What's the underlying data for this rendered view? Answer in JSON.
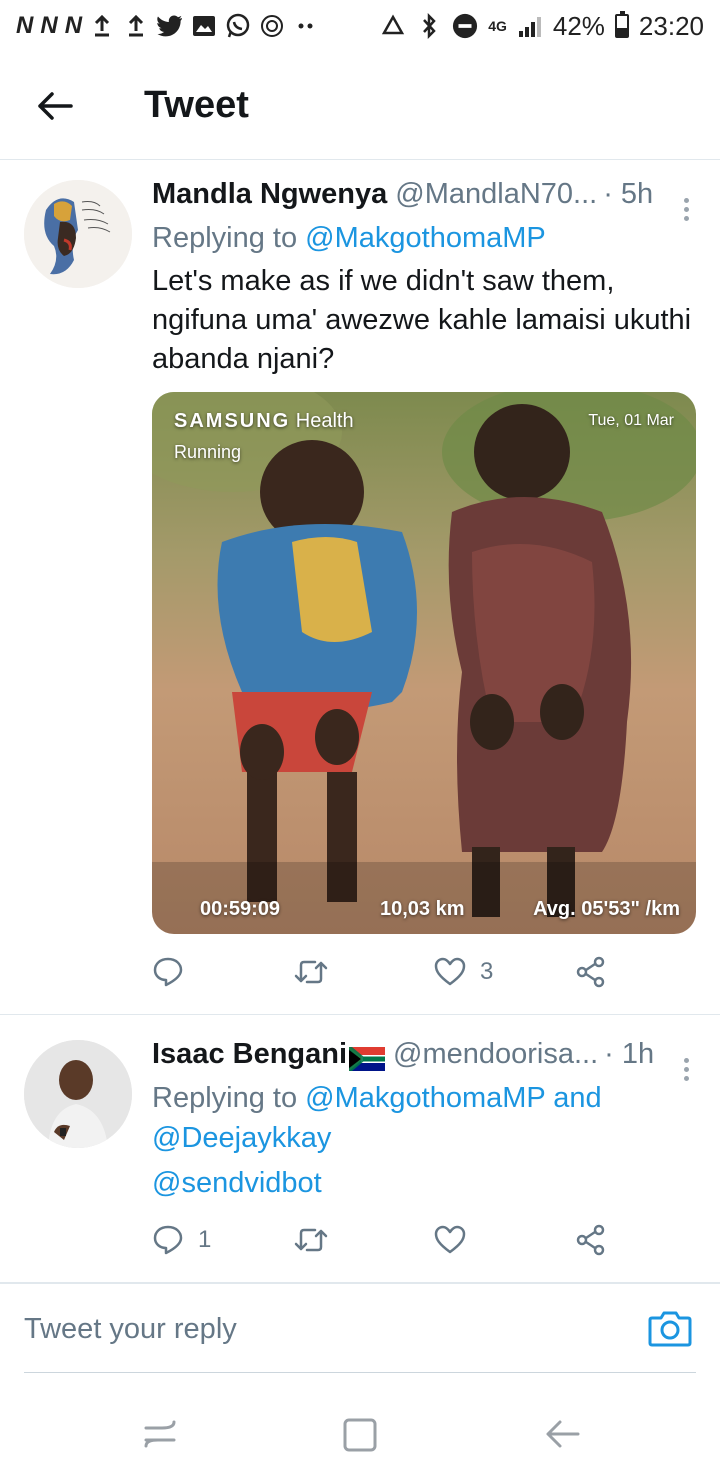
{
  "status_bar": {
    "left_icons": [
      "N",
      "N",
      "N",
      "upload-icon",
      "upload-icon",
      "twitter-icon",
      "gallery-icon",
      "whatsapp-icon",
      "sync-icon",
      "dots-icon"
    ],
    "right_icons": [
      "recycle-icon",
      "bluetooth-icon",
      "do-not-disturb-icon",
      "4g-icon",
      "signal-icon"
    ],
    "network": "4G",
    "battery": "42%",
    "time": "23:20"
  },
  "header": {
    "title": "Tweet"
  },
  "tweets": [
    {
      "name": "Mandla Ngwenya",
      "handle": "@MandlaN70...",
      "time": "· 5h",
      "replying_prefix": "Replying to",
      "replying_to": [
        "@MakgothomaMP"
      ],
      "text": "Let's make as if we didn't saw them, ngifuna uma' awezwe kahle lamaisi ukuthi abanda njani?",
      "media": {
        "brand": "SAMSUNG",
        "brand_suffix": "Health",
        "activity": "Running",
        "date": "Tue, 01 Mar",
        "duration": "00:59:09",
        "distance": "10,03 km",
        "pace": "Avg. 05'53\" /km"
      },
      "actions": {
        "reply_count": "",
        "retweet_count": "",
        "like_count": "3"
      }
    },
    {
      "name": "Isaac Bengani",
      "flag": "south-africa-flag-icon",
      "handle": "@mendoorisa...",
      "time": "· 1h",
      "replying_prefix": "Replying to",
      "replying_to": [
        "@MakgothomaMP",
        "@Deejaykkay"
      ],
      "replying_joiner": "and",
      "text_link": "@sendvidbot",
      "actions": {
        "reply_count": "1",
        "retweet_count": "",
        "like_count": ""
      }
    }
  ],
  "composer": {
    "placeholder": "Tweet your reply"
  },
  "colors": {
    "link": "#1b95e0",
    "secondary_text": "#657786",
    "divider": "#e1e8ed"
  }
}
